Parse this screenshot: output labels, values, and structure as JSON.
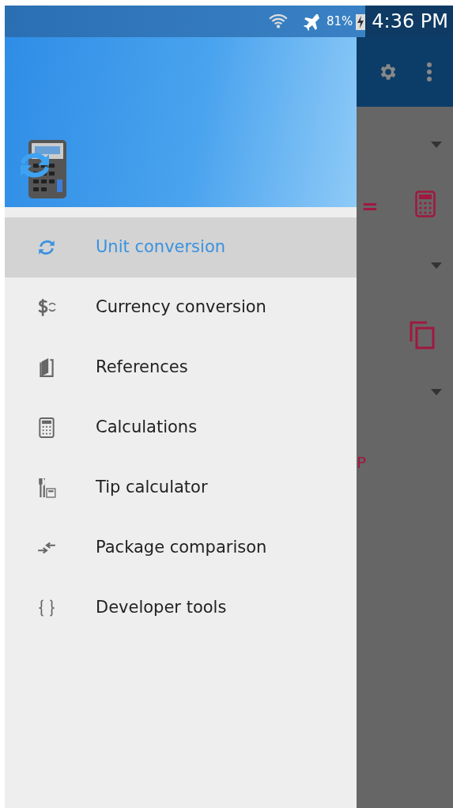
{
  "status_bar": {
    "battery": "81%",
    "time": "4:36 PM"
  },
  "background": {
    "equals_sign": "=",
    "partial_text": "P"
  },
  "drawer": {
    "items": [
      {
        "label": "Unit conversion",
        "kind": "unit",
        "selected": true
      },
      {
        "label": "Currency conversion",
        "kind": "currency",
        "selected": false
      },
      {
        "label": "References",
        "kind": "book",
        "selected": false
      },
      {
        "label": "Calculations",
        "kind": "calculator",
        "selected": false
      },
      {
        "label": "Tip calculator",
        "kind": "tip",
        "selected": false
      },
      {
        "label": "Package comparison",
        "kind": "compare",
        "selected": false
      },
      {
        "label": "Developer tools",
        "kind": "braces",
        "selected": false
      }
    ]
  }
}
